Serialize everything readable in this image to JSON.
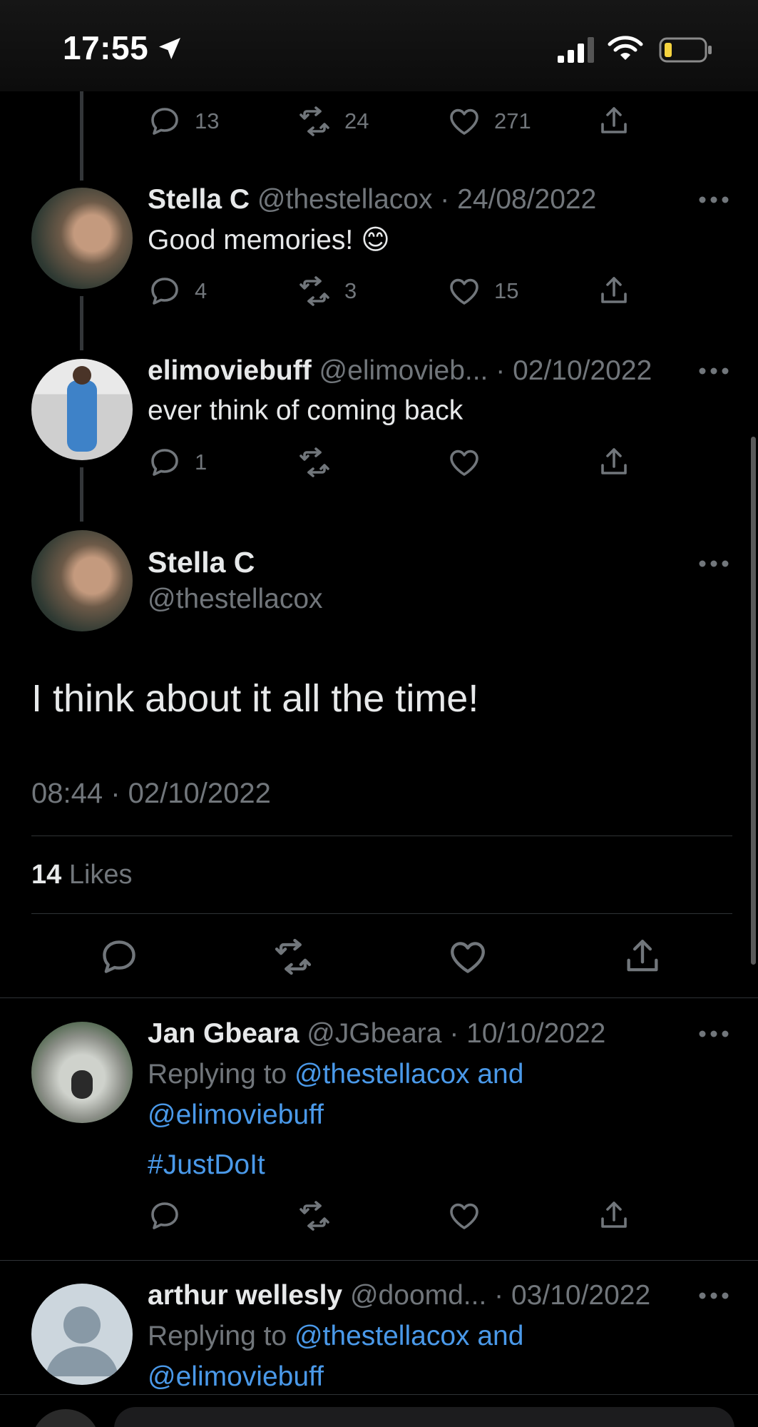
{
  "status_bar": {
    "time": "17:55"
  },
  "prev_tweet_actions": {
    "replies": "13",
    "retweets": "24",
    "likes": "271"
  },
  "thread": [
    {
      "name": "Stella C",
      "handle": "@thestellacox",
      "date": "24/08/2022",
      "text": "Good memories! 😊",
      "replies": "4",
      "retweets": "3",
      "likes": "15"
    },
    {
      "name": "elimoviebuff",
      "handle": "@elimovieb...",
      "date": "02/10/2022",
      "text": "ever think of coming back",
      "replies": "1",
      "retweets": "",
      "likes": ""
    }
  ],
  "main_tweet": {
    "name": "Stella C",
    "handle": "@thestellacox",
    "text": "I think about it all the time!",
    "timestamp": "08:44 · 02/10/2022",
    "likes_count": "14",
    "likes_label": "Likes"
  },
  "replies": [
    {
      "name": "Jan Gbeara",
      "handle": "@JGbeara",
      "date": "10/10/2022",
      "replying_prefix": "Replying to",
      "replying_line1": "@thestellacox and",
      "replying_line2": "@elimoviebuff",
      "text": "#JustDoIt"
    },
    {
      "name": "arthur wellesly",
      "handle": "@doomd...",
      "date": "03/10/2022",
      "replying_prefix": "Replying to",
      "replying_line1": "@thestellacox and",
      "replying_line2": "@elimoviebuff"
    }
  ],
  "colors": {
    "background": "#000000",
    "text": "#e7e9ea",
    "muted": "#71767b",
    "link": "#4a99e9"
  },
  "icons": [
    "location-arrow-icon",
    "signal-icon",
    "wifi-icon",
    "battery-icon",
    "reply-icon",
    "retweet-icon",
    "like-icon",
    "share-icon",
    "more-icon"
  ]
}
